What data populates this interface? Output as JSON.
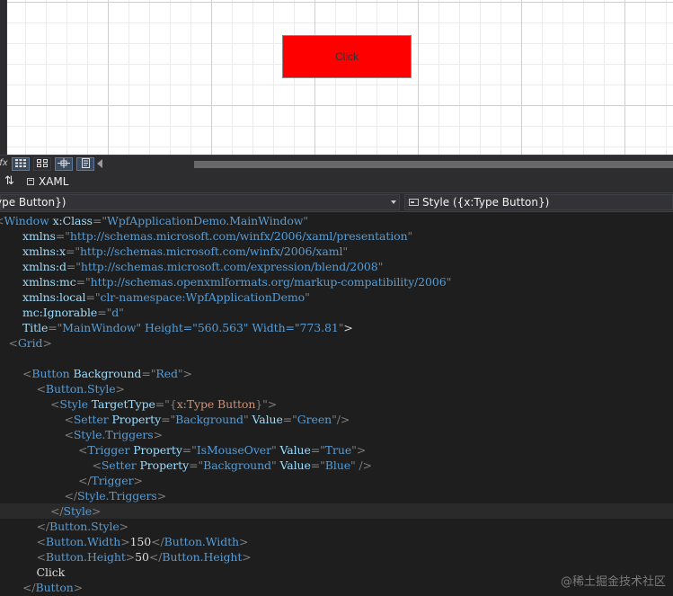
{
  "designer": {
    "preview_button": {
      "label": "Click",
      "background": "#ff0000"
    }
  },
  "toolbar": {
    "formula_icon": "fx",
    "buttons": [
      "grid-view-icon",
      "snap-grid-icon",
      "snap-lines-icon",
      "code-view-icon"
    ]
  },
  "tabs": {
    "swap_glyph": "⇅",
    "xaml_label": "XAML"
  },
  "navbar": {
    "left_text": "ype Button})",
    "right_text": "Style ({x:Type Button})"
  },
  "code": {
    "lines": [
      "<Window x:Class=\"WpfApplicationDemo.MainWindow\"",
      "        xmlns=\"http://schemas.microsoft.com/winfx/2006/xaml/presentation\"",
      "        xmlns:x=\"http://schemas.microsoft.com/winfx/2006/xaml\"",
      "        xmlns:d=\"http://schemas.microsoft.com/expression/blend/2008\"",
      "        xmlns:mc=\"http://schemas.openxmlformats.org/markup-compatibility/2006\"",
      "        xmlns:local=\"clr-namespace:WpfApplicationDemo\"",
      "        mc:Ignorable=\"d\"",
      "        Title=\"MainWindow\" Height=\"560.563\" Width=\"773.81\">",
      "    <Grid>",
      "",
      "        <Button Background=\"Red\">",
      "            <Button.Style>",
      "                <Style TargetType=\"{x:Type Button}\">",
      "                    <Setter Property=\"Background\" Value=\"Green\"/>",
      "                    <Style.Triggers>",
      "                        <Trigger Property=\"IsMouseOver\" Value=\"True\">",
      "                            <Setter Property=\"Background\" Value=\"Blue\" />",
      "                        </Trigger>",
      "                    </Style.Triggers>",
      "                </Style>",
      "            </Button.Style>",
      "            <Button.Width>150</Button.Width>",
      "            <Button.Height>50</Button.Height>",
      "            Click",
      "        </Button>"
    ],
    "current_line": 19
  },
  "watermark": "@稀土掘金技术社区",
  "colors": {
    "editor_bg": "#1e1e1e",
    "punctuation": "#808080",
    "tag": "#569cd6",
    "attribute": "#9cdcfe",
    "value": "#569cd6",
    "markup_extension": "#ce9178",
    "text": "#dcdcdc"
  }
}
